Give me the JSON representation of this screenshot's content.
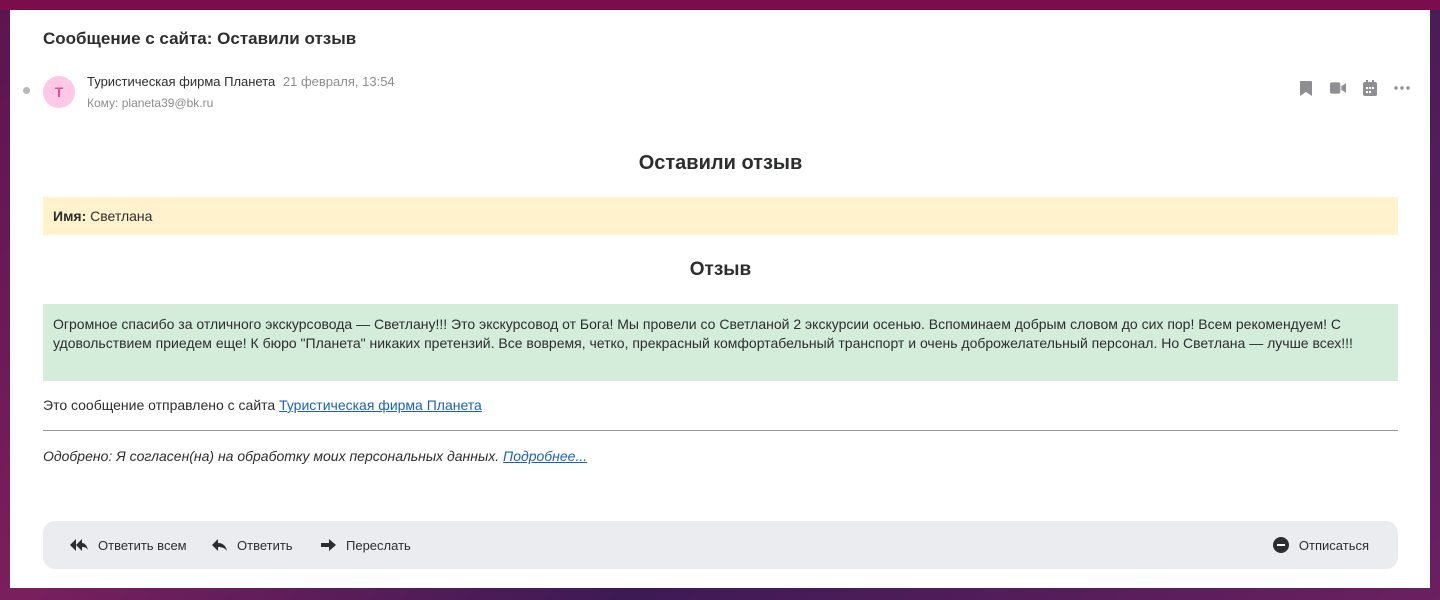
{
  "email": {
    "subject": "Сообщение с сайта: Оставили отзыв",
    "avatar_letter": "Т",
    "sender_name": "Туристическая фирма Планета",
    "date": "21 февраля, 13:54",
    "to_label": "Кому:",
    "to_address": "planeta39@bk.ru"
  },
  "body": {
    "title": "Оставили отзыв",
    "name_label": "Имя:",
    "name_value": "Светлана",
    "review_title": "Отзыв",
    "review_text": "Огромное спасибо за отличного экскурсовода — Светлану!!! Это экскурсовод от Бога! Мы провели со Светланой 2 экскурсии осенью. Вспоминаем добрым словом до сих пор! Всем рекомендуем! С удовольствием приедем еще! К бюро \"Планета\" никаких претензий. Все вовремя, четко, прекрасный комфортабельный транспорт и очень доброжелательный персонал. Но Светлана — лучше всех!!!",
    "sent_prefix": "Это сообщение отправлено с сайта",
    "sent_link": "Туристическая фирма Планета",
    "agree_text": "Одобрено: Я согласен(на) на обработку моих персональных данных.",
    "agree_link": "Подробнее..."
  },
  "footer": {
    "reply_all": "Ответить всем",
    "reply": "Ответить",
    "forward": "Переслать",
    "unsubscribe": "Отписаться"
  },
  "icons": {
    "top_actions": [
      "bookmark-icon",
      "video-icon",
      "calendar-icon",
      "more-icon"
    ],
    "footer": [
      "reply-all-icon",
      "reply-icon",
      "forward-icon",
      "unsubscribe-icon"
    ]
  },
  "colors": {
    "avatar_bg": "#ffc8e6",
    "avatar_fg": "#e64b9d",
    "name_box": "#fff2cc",
    "review_box": "#d4eddb",
    "link": "#1a62b9",
    "footer_bar": "#ebecf0"
  }
}
